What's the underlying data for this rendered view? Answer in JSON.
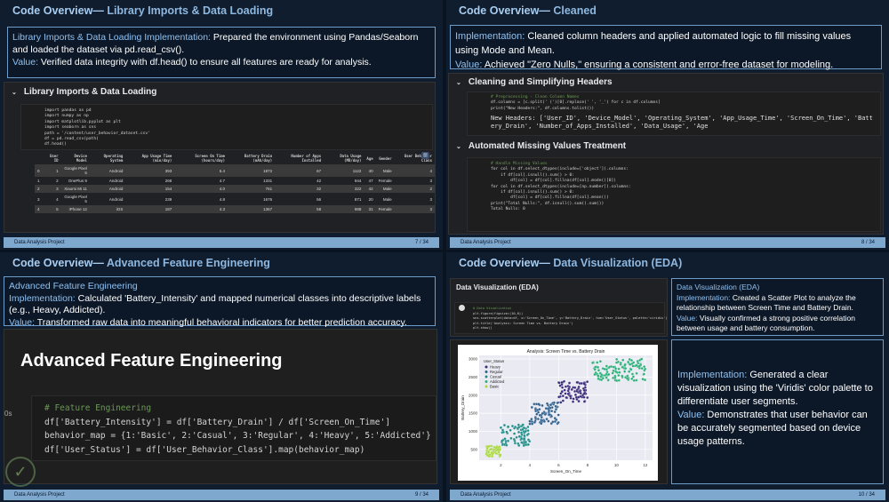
{
  "footer_project": "Data Analysis Project",
  "slides": [
    {
      "title_prefix": "Code Overview—",
      "title_sub": "Library Imports & Data Loading",
      "impl_label": "Library Imports & Data Loading Implementation:",
      "impl_text": " Prepared the environment using Pandas/Seaborn and loaded the dataset via pd.read_csv().",
      "value_label": "Value:",
      "value_text": " Verified data integrity with df.head() to ensure all features are ready for analysis.",
      "nb_heading": "Library Imports & Data Loading",
      "code": [
        "import pandas as pd",
        "import numpy as np",
        "import matplotlib.pyplot as plt",
        "import seaborn as sns",
        "path = '/content/user_behavior_dataset.csv'",
        "df = pd.read_csv(path)",
        "df.head()"
      ],
      "table": {
        "headers": [
          "",
          "User ID",
          "Device Model",
          "Operating System",
          "App Usage Time (min/day)",
          "Screen On Time (hours/day)",
          "Battery Drain (mAh/day)",
          "Number of Apps Installed",
          "Data Usage (MB/day)",
          "Age",
          "Gender",
          "User Behavior Class"
        ],
        "rows": [
          [
            "0",
            "1",
            "Google Pixel 5",
            "Android",
            "393",
            "6.4",
            "1872",
            "67",
            "1122",
            "40",
            "Male",
            "4"
          ],
          [
            "1",
            "2",
            "OnePlus 9",
            "Android",
            "268",
            "4.7",
            "1331",
            "42",
            "944",
            "47",
            "Female",
            "3"
          ],
          [
            "2",
            "3",
            "Xiaomi Mi 11",
            "Android",
            "154",
            "4.0",
            "761",
            "32",
            "322",
            "42",
            "Male",
            "2"
          ],
          [
            "3",
            "4",
            "Google Pixel 5",
            "Android",
            "239",
            "4.8",
            "1676",
            "56",
            "871",
            "20",
            "Male",
            "3"
          ],
          [
            "4",
            "5",
            "iPhone 12",
            "iOS",
            "187",
            "4.3",
            "1367",
            "58",
            "988",
            "31",
            "Female",
            "3"
          ]
        ]
      },
      "page": "7 / 34"
    },
    {
      "title_prefix": "Code Overview—",
      "title_sub": "Cleaned",
      "impl_label": "Implementation:",
      "impl_text": " Cleaned column headers and applied automated logic to fill missing values using Mode and Mean.",
      "value_label": "Value:",
      "value_text": " Achieved \"Zero Nulls,\" ensuring a consistent and error-free dataset for modeling.",
      "nb_heading1": "Cleaning and Simplifying Headers",
      "code1": [
        "# Preprocessing - Clean Column Names",
        "df.columns = [c.split(' (')[0].replace(' ', '_') for c in df.columns]",
        "print(\"New Headers:\", df.columns.tolist())"
      ],
      "output1": "New Headers: ['User_ID', 'Device_Model', 'Operating_System', 'App_Usage_Time', 'Screen_On_Time', 'Battery_Drain', 'Number_of_Apps_Installed', 'Data_Usage', 'Age",
      "nb_heading2": "Automated Missing Values Treatment",
      "code2": [
        "# Handle Missing Values",
        "for col in df.select_dtypes(include=['object']).columns:",
        "    if df[col].isnull().sum() > 0:",
        "        df[col] = df[col].fillna(df[col].mode()[0])",
        "for col in df.select_dtypes(include=[np.number]).columns:",
        "    if df[col].isnull().sum() > 0:",
        "        df[col] = df[col].fillna(df[col].mean())",
        "print(\"Total Nulls:\", df.isnull().sum().sum())"
      ],
      "output2": "Total Nulls: 0",
      "page": "8 / 34"
    },
    {
      "title_prefix": "Code Overview—",
      "title_sub": "Advanced Feature Engineering",
      "heading_label": "Advanced Feature Engineering",
      "impl_label": "Implementation:",
      "impl_text": " Calculated 'Battery_Intensity' and mapped numerical classes into descriptive labels (e.g., Heavy, Addicted).",
      "value_label": "Value:",
      "value_text": " Transformed raw data into meaningful behavioral indicators for better prediction accuracy.",
      "nb_heading": "Advanced Feature Engineering",
      "code": [
        "# Feature Engineering",
        "df['Battery_Intensity'] = df['Battery_Drain'] / df['Screen_On_Time']",
        "behavior_map = {1:'Basic', 2:'Casual', 3:'Regular', 4:'Heavy', 5:'Addicted'}",
        "df['User_Status'] = df['User_Behavior_Class'].map(behavior_map)"
      ],
      "cell_marker": "0s",
      "page": "9 / 34"
    },
    {
      "title_prefix": "Code Overview—",
      "title_sub": "Data Visualization  (EDA)",
      "nb_heading": "Data Visualization (EDA)",
      "code": [
        "# Data Visualization",
        "plt.figure(figsize=(10,6))",
        "sns.scatterplot(data=df, x='Screen_On_Time', y='Battery_Drain', hue='User_Status', palette='viridis')",
        "plt.title('Analysis: Screen Time vs. Battery Drain')",
        "plt.show()"
      ],
      "box1_heading": "Data Visualization (EDA)",
      "box1_impl_label": "Implementation:",
      "box1_impl_text": " Created a Scatter Plot to analyze the relationship between Screen Time and Battery Drain.",
      "box1_value_label": "Value:",
      "box1_value_text": " Visually confirmed a strong positive correlation between usage and battery consumption.",
      "box2_impl_label": "Implementation:",
      "box2_impl_text": " Generated a clear visualization using the 'Viridis' color palette to differentiate user segments.",
      "box2_value_label": "Value:",
      "box2_value_text": " Demonstrates that user behavior can be accurately segmented based on device usage patterns.",
      "page": "10 / 34"
    }
  ],
  "chart_data": {
    "type": "scatter",
    "title": "Analysis: Screen Time vs. Battery Drain",
    "xlabel": "Screen_On_Time",
    "ylabel": "Battery_Drain",
    "xlim": [
      0.5,
      12.5
    ],
    "ylim": [
      200,
      3100
    ],
    "xticks": [
      2,
      4,
      6,
      8,
      10,
      12
    ],
    "yticks": [
      500,
      1000,
      1500,
      2000,
      2500,
      3000
    ],
    "legend_title": "User_Status",
    "legend_position": "top-left",
    "series": [
      {
        "name": "Heavy",
        "color": "#3b2a7a",
        "x_range": [
          6,
          8
        ],
        "y_range": [
          1800,
          2400
        ],
        "count": 80
      },
      {
        "name": "Regular",
        "color": "#2f5f8c",
        "x_range": [
          4,
          6
        ],
        "y_range": [
          1200,
          1800
        ],
        "count": 80
      },
      {
        "name": "Casual",
        "color": "#1f8c88",
        "x_range": [
          2,
          4
        ],
        "y_range": [
          600,
          1200
        ],
        "count": 80
      },
      {
        "name": "Addicted",
        "color": "#2cb07a",
        "x_range": [
          8.3,
          12
        ],
        "y_range": [
          2400,
          3000
        ],
        "count": 120
      },
      {
        "name": "Basic",
        "color": "#a6d63a",
        "x_range": [
          1,
          2
        ],
        "y_range": [
          300,
          600
        ],
        "count": 60
      }
    ]
  }
}
